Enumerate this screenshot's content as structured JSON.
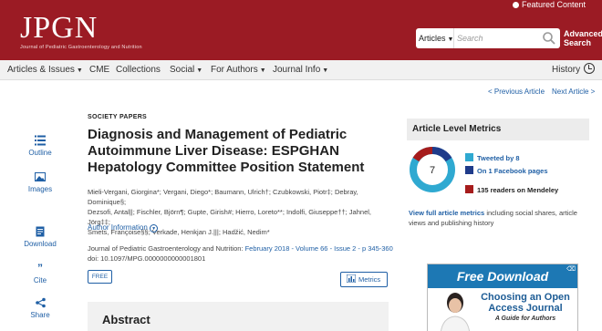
{
  "header": {
    "logo_text": "JPGN",
    "logo_sub": "Journal of Pediatric Gastroenterology and Nutrition",
    "top_link": "Featured Content",
    "search": {
      "type_label": "Articles",
      "placeholder": "Search"
    },
    "advanced_search": [
      "Advanced",
      "Search"
    ],
    "bg_color": "#9b1b24"
  },
  "nav": {
    "items": [
      {
        "label": "Articles & Issues",
        "dropdown": true
      },
      {
        "label": "CME",
        "dropdown": false
      },
      {
        "label": "Collections",
        "dropdown": false
      },
      {
        "label": "Social",
        "dropdown": true
      },
      {
        "label": "For Authors",
        "dropdown": true
      },
      {
        "label": "Journal Info",
        "dropdown": true
      }
    ],
    "history": "History"
  },
  "pager": {
    "prev": "< Previous Article",
    "next": "Next Article >"
  },
  "sidebar": {
    "items": [
      {
        "label": "Outline",
        "icon": "list-icon"
      },
      {
        "label": "Images",
        "icon": "images-icon"
      },
      {
        "label": "Download",
        "icon": "download-icon"
      },
      {
        "label": "Cite",
        "icon": "quote-icon"
      },
      {
        "label": "Share",
        "icon": "share-icon"
      }
    ]
  },
  "article": {
    "section": "SOCIETY PAPERS",
    "title": "Diagnosis and Management of Pediatric Autoimmune Liver Disease: ESPGHAN Hepatology Committee Position Statement",
    "authors_line1": "Mieli-Vergani, Giorgina*; Vergani, Diego*; Baumann, Ulrich†; Czubkowski, Piotr‡; Debray, Dominique§;",
    "authors_line2": "Dezsofi, Antal||; Fischler, Björn¶; Gupte, Girish#; Hierro, Loreto**; Indolfi, Giuseppe††; Jahnel, Jörg‡‡;",
    "authors_line3": "Smets, Françoise§§; Verkade, Henkjan J.|||; Hadžić, Nedim*",
    "author_info": "Author Information",
    "journal_prefix": "Journal of Pediatric Gastroenterology and Nutrition: ",
    "journal_link": "February 2018 - Volume 66 - Issue 2 - p 345-360",
    "doi": "doi: 10.1097/MPG.0000000000001801",
    "free_badge": "FREE",
    "metrics_button": "Metrics",
    "abstract_heading": "Abstract"
  },
  "metrics": {
    "heading": "Article Level Metrics",
    "score": "7",
    "rows": [
      {
        "prefix": "",
        "link": "Tweeted by 8",
        "color": "#2fa9d1"
      },
      {
        "prefix": "",
        "link": "On 1 Facebook pages",
        "color": "#1f3b8a"
      },
      {
        "prefix": "",
        "link": "135 readers on Mendeley",
        "color": "#a61c1c"
      }
    ],
    "view_all_link": "View full article metrics",
    "view_all_rest": " including social shares, article views and publishing history"
  },
  "ad": {
    "banner": "Free Download",
    "headline": "Choosing an Open Access Journal",
    "sub": "A Guide for Authors"
  }
}
